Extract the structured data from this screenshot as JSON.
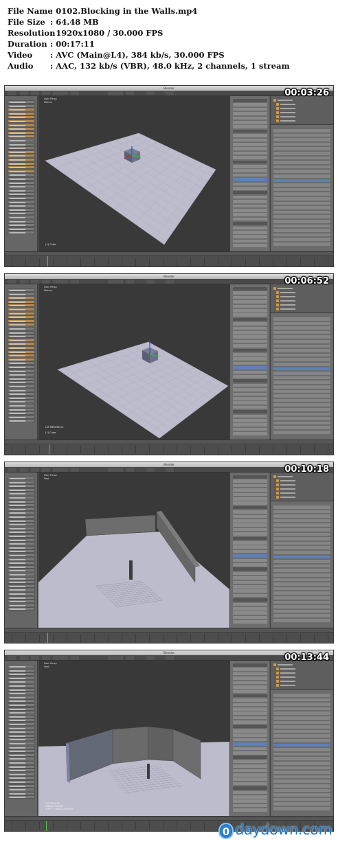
{
  "meta": {
    "file_name_label": "File Name",
    "file_name": ": 0102.Blocking in the Walls.mp4",
    "file_size_label": "File Size",
    "file_size": ": 64.48 MB",
    "resolution_label": "Resolution",
    "resolution": ": 1920x1080 / 30.000 FPS",
    "duration_label": "Duration",
    "duration": ": 00:17:11",
    "video_label": "Video",
    "video": ": AVC (Main@L4), 384 kb/s, 30.000 FPS",
    "audio_label": "Audio",
    "audio": ": AAC, 132 kb/s (VBR), 48.0 kHz, 2 channels, 1 stream"
  },
  "frames": [
    {
      "timestamp": "00:03:26",
      "window_title": "Blender",
      "viewport_label": "User Persp",
      "viewport_sublabel": "Meters",
      "status_text": "(1) Cube"
    },
    {
      "timestamp": "00:06:52",
      "window_title": "Blender",
      "viewport_label": "User Persp",
      "viewport_sublabel": "Meters",
      "status_text": "LEFTMOUSE x2\n\n(1) Cube"
    },
    {
      "timestamp": "00:10:18",
      "window_title": "Blender",
      "viewport_label": "User Persp",
      "viewport_sublabel": "Feet",
      "status_text": ""
    },
    {
      "timestamp": "00:13:44",
      "window_title": "Blender",
      "viewport_label": "User Persp",
      "viewport_sublabel": "Feet",
      "status_text": "LEFTMOUSE\nMIDDLEMOUSE\nSHIFT + MIDDLEMOUSE"
    }
  ],
  "colors": {
    "floor": "#bcbccc",
    "floor_edge": "#a9a9bb",
    "wall_face": "#6a6a6a",
    "wall_dark": "#4c4c4c",
    "accent_orange": "#d29a46",
    "accent_blue": "#5f80b7"
  },
  "watermark": {
    "icon_letter": "0",
    "text": "daydown.com"
  }
}
